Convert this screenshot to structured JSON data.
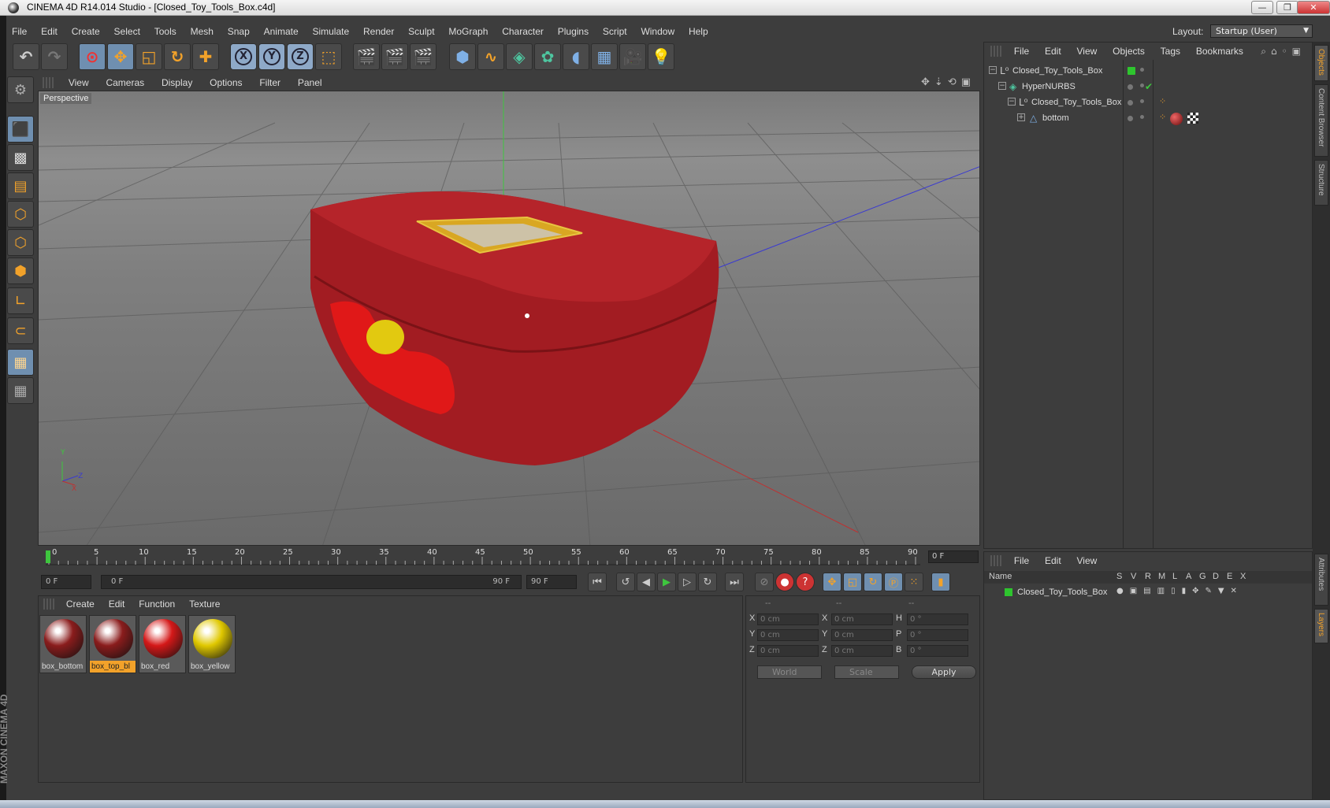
{
  "window": {
    "title": "CINEMA 4D R14.014 Studio - [Closed_Toy_Tools_Box.c4d]",
    "minimize": "—",
    "restore": "❐",
    "close": "✕"
  },
  "menu": [
    "File",
    "Edit",
    "Create",
    "Select",
    "Tools",
    "Mesh",
    "Snap",
    "Animate",
    "Simulate",
    "Render",
    "Sculpt",
    "MoGraph",
    "Character",
    "Plugins",
    "Script",
    "Window",
    "Help"
  ],
  "layout": {
    "label": "Layout:",
    "value": "Startup (User)"
  },
  "toolbar": {
    "undo": "undo-icon",
    "redo": "redo-icon",
    "axis_x": "X",
    "axis_y": "Y",
    "axis_z": "Z"
  },
  "viewport": {
    "menu": [
      "View",
      "Cameras",
      "Display",
      "Options",
      "Filter",
      "Panel"
    ],
    "camera_label": "Perspective",
    "axis_y": "Y",
    "axis_x": "X",
    "axis_z": "Z"
  },
  "timeline": {
    "ticks": [
      "0",
      "5",
      "10",
      "15",
      "20",
      "25",
      "30",
      "35",
      "40",
      "45",
      "50",
      "55",
      "60",
      "65",
      "70",
      "75",
      "80",
      "85",
      "90"
    ],
    "current_frame": "0 F",
    "start": "0 F",
    "range_start": "0 F",
    "range_end": "90 F",
    "end": "90 F"
  },
  "materials": {
    "menu": [
      "Create",
      "Edit",
      "Function",
      "Texture"
    ],
    "items": [
      {
        "name": "box_bottom",
        "color": "#8a1c1c"
      },
      {
        "name": "box_top_bl",
        "color": "#8a1c1c"
      },
      {
        "name": "box_red",
        "color": "#d41818"
      },
      {
        "name": "box_yellow",
        "color": "#e0c800"
      }
    ]
  },
  "coordinates": {
    "headers": [
      "--",
      "--",
      "--"
    ],
    "rows": [
      {
        "l1": "X",
        "v1": "0 cm",
        "l2": "X",
        "v2": "0 cm",
        "l3": "H",
        "v3": "0 °"
      },
      {
        "l1": "Y",
        "v1": "0 cm",
        "l2": "Y",
        "v2": "0 cm",
        "l3": "P",
        "v3": "0 °"
      },
      {
        "l1": "Z",
        "v1": "0 cm",
        "l2": "Z",
        "v2": "0 cm",
        "l3": "B",
        "v3": "0 °"
      }
    ],
    "space": "World",
    "mode": "Scale",
    "apply": "Apply"
  },
  "objects": {
    "menu": [
      "File",
      "Edit",
      "View",
      "Objects",
      "Tags",
      "Bookmarks"
    ],
    "items": [
      {
        "label": "Closed_Toy_Tools_Box",
        "indent": 0
      },
      {
        "label": "HyperNURBS",
        "indent": 1
      },
      {
        "label": "Closed_Toy_Tools_Box",
        "indent": 2
      },
      {
        "label": "bottom",
        "indent": 3
      }
    ]
  },
  "layers": {
    "menu": [
      "File",
      "Edit",
      "View"
    ],
    "columns": [
      "Name",
      "S",
      "V",
      "R",
      "M",
      "L",
      "A",
      "G",
      "D",
      "E",
      "X"
    ],
    "items": [
      {
        "label": "Closed_Toy_Tools_Box",
        "color": "#2ec52e"
      }
    ]
  },
  "side_tabs": [
    "Objects",
    "Content Browser",
    "Structure",
    "Attributes",
    "Layers"
  ],
  "brand": "MAXON CINEMA 4D",
  "colors": {
    "accent": "#f2a22a",
    "panel": "#3d3d3d",
    "selection": "#6f8fb0"
  }
}
